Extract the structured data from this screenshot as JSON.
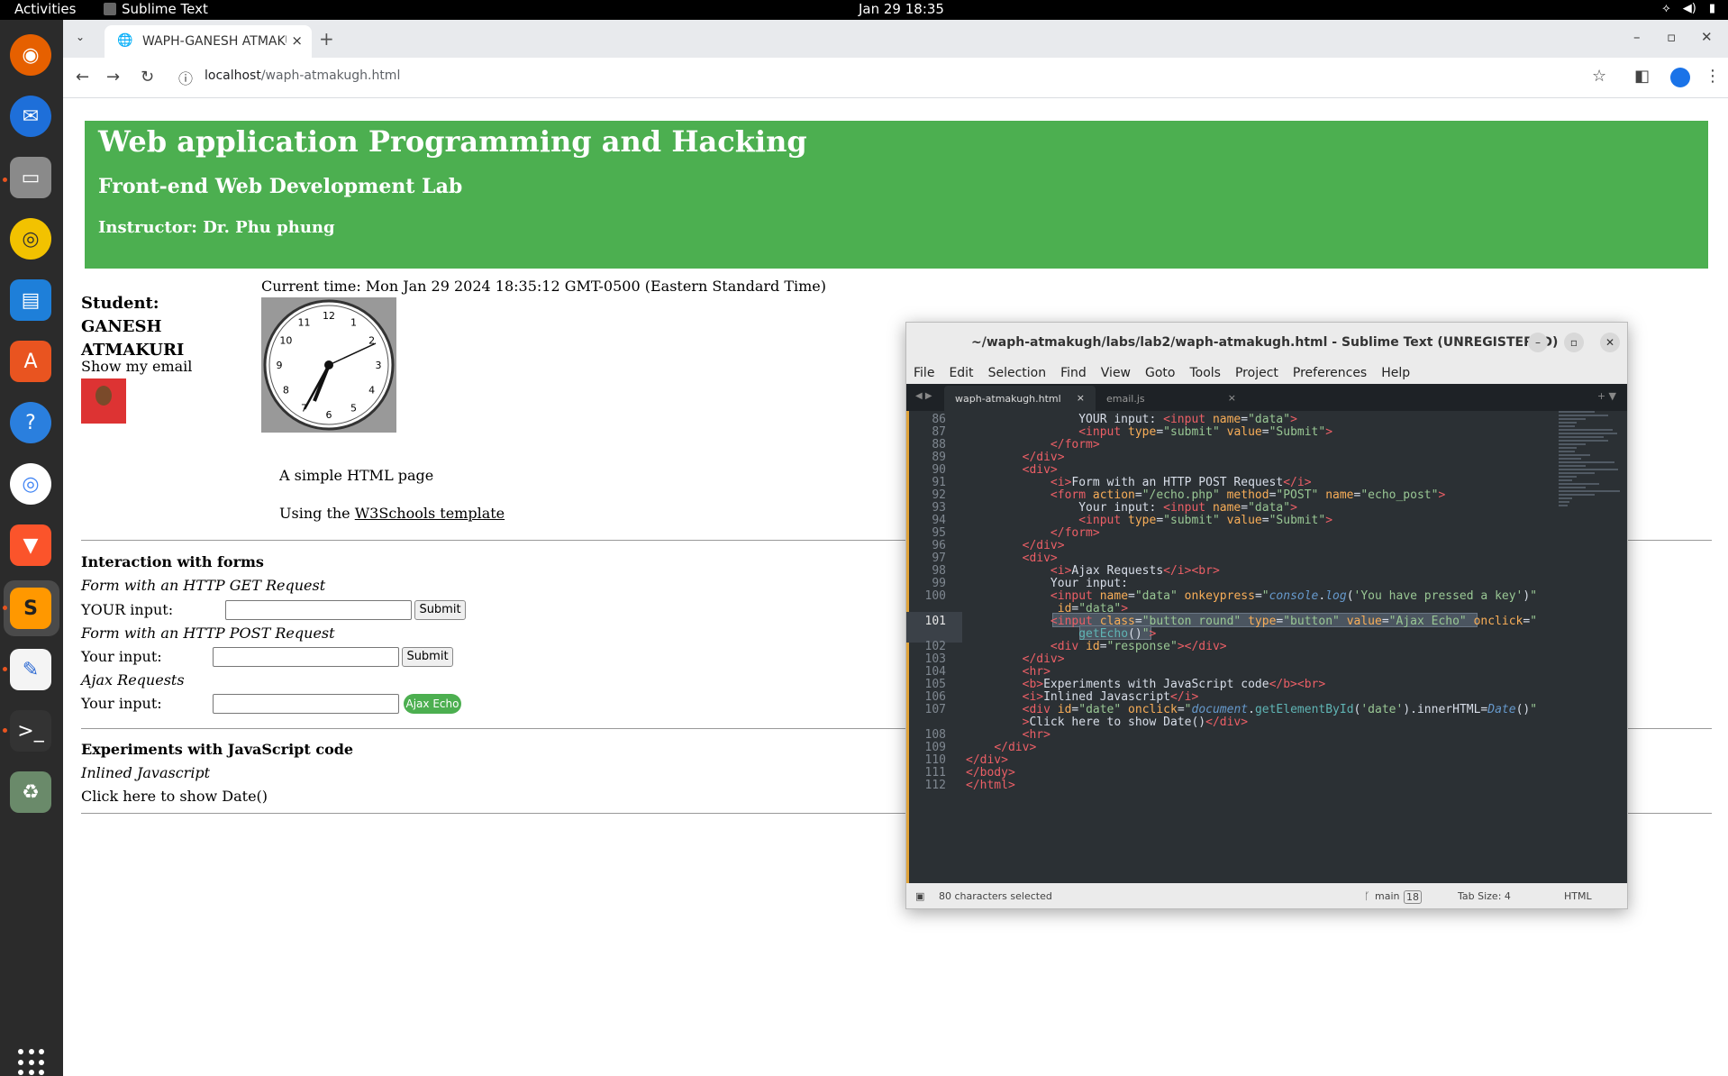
{
  "topbar": {
    "activities": "Activities",
    "app_name": "Sublime Text",
    "clock": "Jan 29  18:35"
  },
  "browser": {
    "tab_title": "WAPH-GANESH ATMAKURI",
    "url_host": "localhost",
    "url_path": "/waph-atmakugh.html"
  },
  "page": {
    "title": "Web application Programming and Hacking",
    "subtitle": "Front-end Web Development Lab",
    "instructor": "Instructor: Dr. Phu phung",
    "student": "Student: GANESH ATMAKURI",
    "show_email": "Show my email",
    "current_time": "Current time: Mon Jan 29 2024 18:35:12 GMT-0500 (Eastern Standard Time)",
    "simple": "A simple HTML page",
    "using_prefix": "Using the ",
    "using_link": "W3Schools template",
    "forms_heading": "Interaction with forms",
    "get_label": "Form with an HTTP GET Request",
    "get_input_label": "YOUR input:",
    "submit": "Submit",
    "post_label": "Form with an HTTP POST Request",
    "post_input_label": "Your input:",
    "ajax_label": "Ajax Requests",
    "ajax_input_label": "Your input:",
    "ajax_button": "Ajax Echo",
    "js_heading": "Experiments with JavaScript code",
    "inline_label": "Inlined Javascript",
    "date_click": "Click here to show Date()"
  },
  "clock_numbers": [
    "12",
    "1",
    "2",
    "3",
    "4",
    "5",
    "6",
    "7",
    "8",
    "9",
    "10",
    "11"
  ],
  "sublime": {
    "title": "~/waph-atmakugh/labs/lab2/waph-atmakugh.html - Sublime Text (UNREGISTERED)",
    "menu": [
      "File",
      "Edit",
      "Selection",
      "Find",
      "View",
      "Goto",
      "Tools",
      "Project",
      "Preferences",
      "Help"
    ],
    "tab_active": "waph-atmakugh.html",
    "tab_other": "email.js",
    "status_selected": "80 characters selected",
    "status_branch": "main",
    "status_branch_count": "18",
    "status_tabsize": "Tab Size: 4",
    "status_syntax": "HTML",
    "line_numbers": [
      "86",
      "87",
      "88",
      "89",
      "90",
      "91",
      "92",
      "93",
      "94",
      "95",
      "96",
      "97",
      "98",
      "99",
      "100",
      "101",
      "102",
      "103",
      "104",
      "105",
      "106",
      "107",
      "108",
      "109",
      "110",
      "111",
      "112"
    ]
  }
}
